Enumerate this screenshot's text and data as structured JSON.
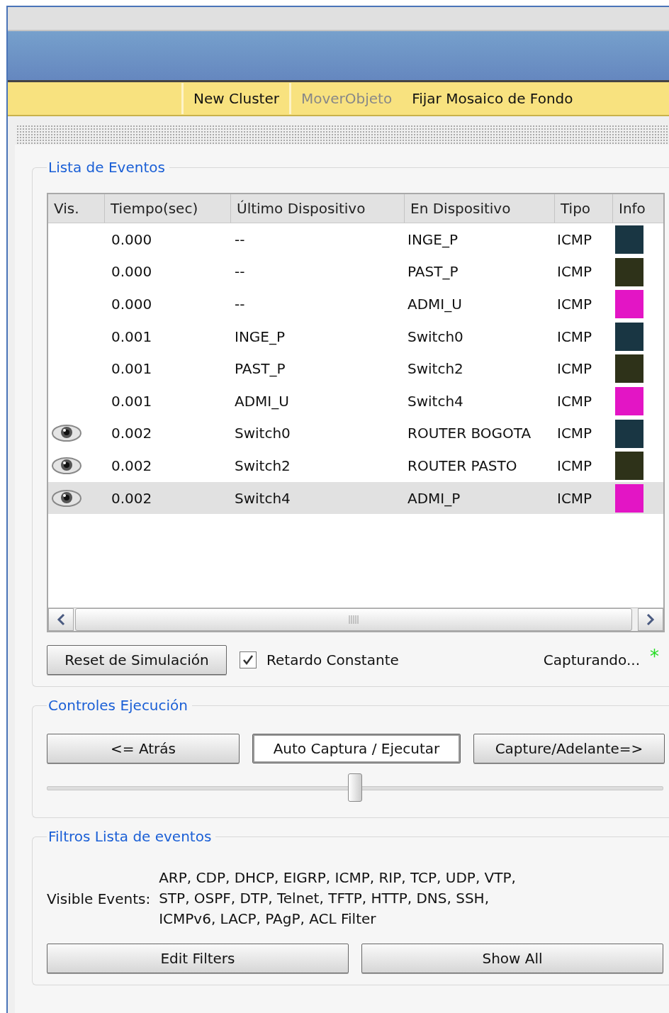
{
  "toolbar": {
    "items": [
      {
        "label": "New Cluster",
        "disabled": false
      },
      {
        "label": "MoverObjeto",
        "disabled": true
      },
      {
        "label": "Fijar Mosaico de Fondo",
        "disabled": false
      }
    ]
  },
  "event_list": {
    "title": "Lista de Eventos",
    "columns": [
      "Vis.",
      "Tiempo(sec)",
      "Último Dispositivo",
      "En Dispositivo",
      "Tipo",
      "Info"
    ],
    "rows": [
      {
        "visible": false,
        "time": "0.000",
        "last_device": "--",
        "at_device": "INGE_P",
        "type": "ICMP",
        "color": "#193643",
        "selected": false
      },
      {
        "visible": false,
        "time": "0.000",
        "last_device": "--",
        "at_device": "PAST_P",
        "type": "ICMP",
        "color": "#2e3219",
        "selected": false
      },
      {
        "visible": false,
        "time": "0.000",
        "last_device": "--",
        "at_device": "ADMI_U",
        "type": "ICMP",
        "color": "#e315c5",
        "selected": false
      },
      {
        "visible": false,
        "time": "0.001",
        "last_device": "INGE_P",
        "at_device": "Switch0",
        "type": "ICMP",
        "color": "#193643",
        "selected": false
      },
      {
        "visible": false,
        "time": "0.001",
        "last_device": "PAST_P",
        "at_device": "Switch2",
        "type": "ICMP",
        "color": "#2e3219",
        "selected": false
      },
      {
        "visible": false,
        "time": "0.001",
        "last_device": "ADMI_U",
        "at_device": "Switch4",
        "type": "ICMP",
        "color": "#e315c5",
        "selected": false
      },
      {
        "visible": true,
        "time": "0.002",
        "last_device": "Switch0",
        "at_device": "ROUTER BOGOTA",
        "type": "ICMP",
        "color": "#193643",
        "selected": false
      },
      {
        "visible": true,
        "time": "0.002",
        "last_device": "Switch2",
        "at_device": "ROUTER PASTO",
        "type": "ICMP",
        "color": "#2e3219",
        "selected": false
      },
      {
        "visible": true,
        "time": "0.002",
        "last_device": "Switch4",
        "at_device": "ADMI_P",
        "type": "ICMP",
        "color": "#e315c5",
        "selected": true
      }
    ],
    "reset_button": "Reset de Simulación",
    "constant_delay": {
      "label": "Retardo Constante",
      "checked": true
    },
    "status": "Capturando...",
    "status_mark": "*"
  },
  "play_controls": {
    "title": "Controles Ejecución",
    "buttons": [
      {
        "label": "<= Atrás",
        "pressed": false
      },
      {
        "label": "Auto Captura / Ejecutar",
        "pressed": true
      },
      {
        "label": "Capture/Adelante=>",
        "pressed": false
      }
    ],
    "speed": {
      "level": 0.5
    }
  },
  "filters": {
    "title": "Filtros Lista de eventos",
    "label": "Visible Events:",
    "events": "ARP, CDP, DHCP, EIGRP, ICMP, RIP, TCP, UDP, VTP, STP, OSPF, DTP, Telnet, TFTP, HTTP, DNS, SSH, ICMPv6, LACP, PAgP, ACL Filter",
    "buttons": [
      "Edit Filters",
      "Show All"
    ]
  }
}
